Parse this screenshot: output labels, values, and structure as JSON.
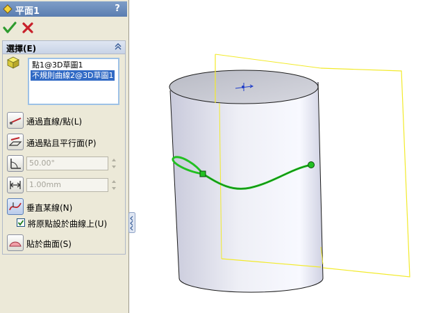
{
  "panel": {
    "title": "平面1",
    "help": "?",
    "selection_header": "選擇(E)",
    "selection_items": [
      "點1@3D草圖1",
      "不規則曲線2@3D草圖1"
    ],
    "options": [
      {
        "label": "通過直線/點(L)"
      },
      {
        "label": "通過點且平行面(P)"
      }
    ],
    "angle_value": "50.00°",
    "distance_value": "1.00mm",
    "normal_label": "垂直某線(N)",
    "origin_checkbox_label": "將原點設於曲線上(U)",
    "origin_checkbox_checked": true,
    "on_surface_label": "貼於曲面(S)"
  },
  "colors": {
    "ok_green": "#2e9b2e",
    "cancel_red": "#c8202a",
    "curve_green": "#22c022",
    "plane_yellow": "#f2ea2a",
    "selection_blue": "#316ac5"
  },
  "icons": [
    "plane-feature-icon",
    "help-icon",
    "ok-check-icon",
    "cancel-x-icon",
    "collapse-chevron-icon",
    "entity-cube-icon",
    "line-point-icon",
    "parallel-plane-icon",
    "angle-icon",
    "distance-icon",
    "normal-curve-icon",
    "on-surface-icon",
    "panel-resize-handle"
  ]
}
